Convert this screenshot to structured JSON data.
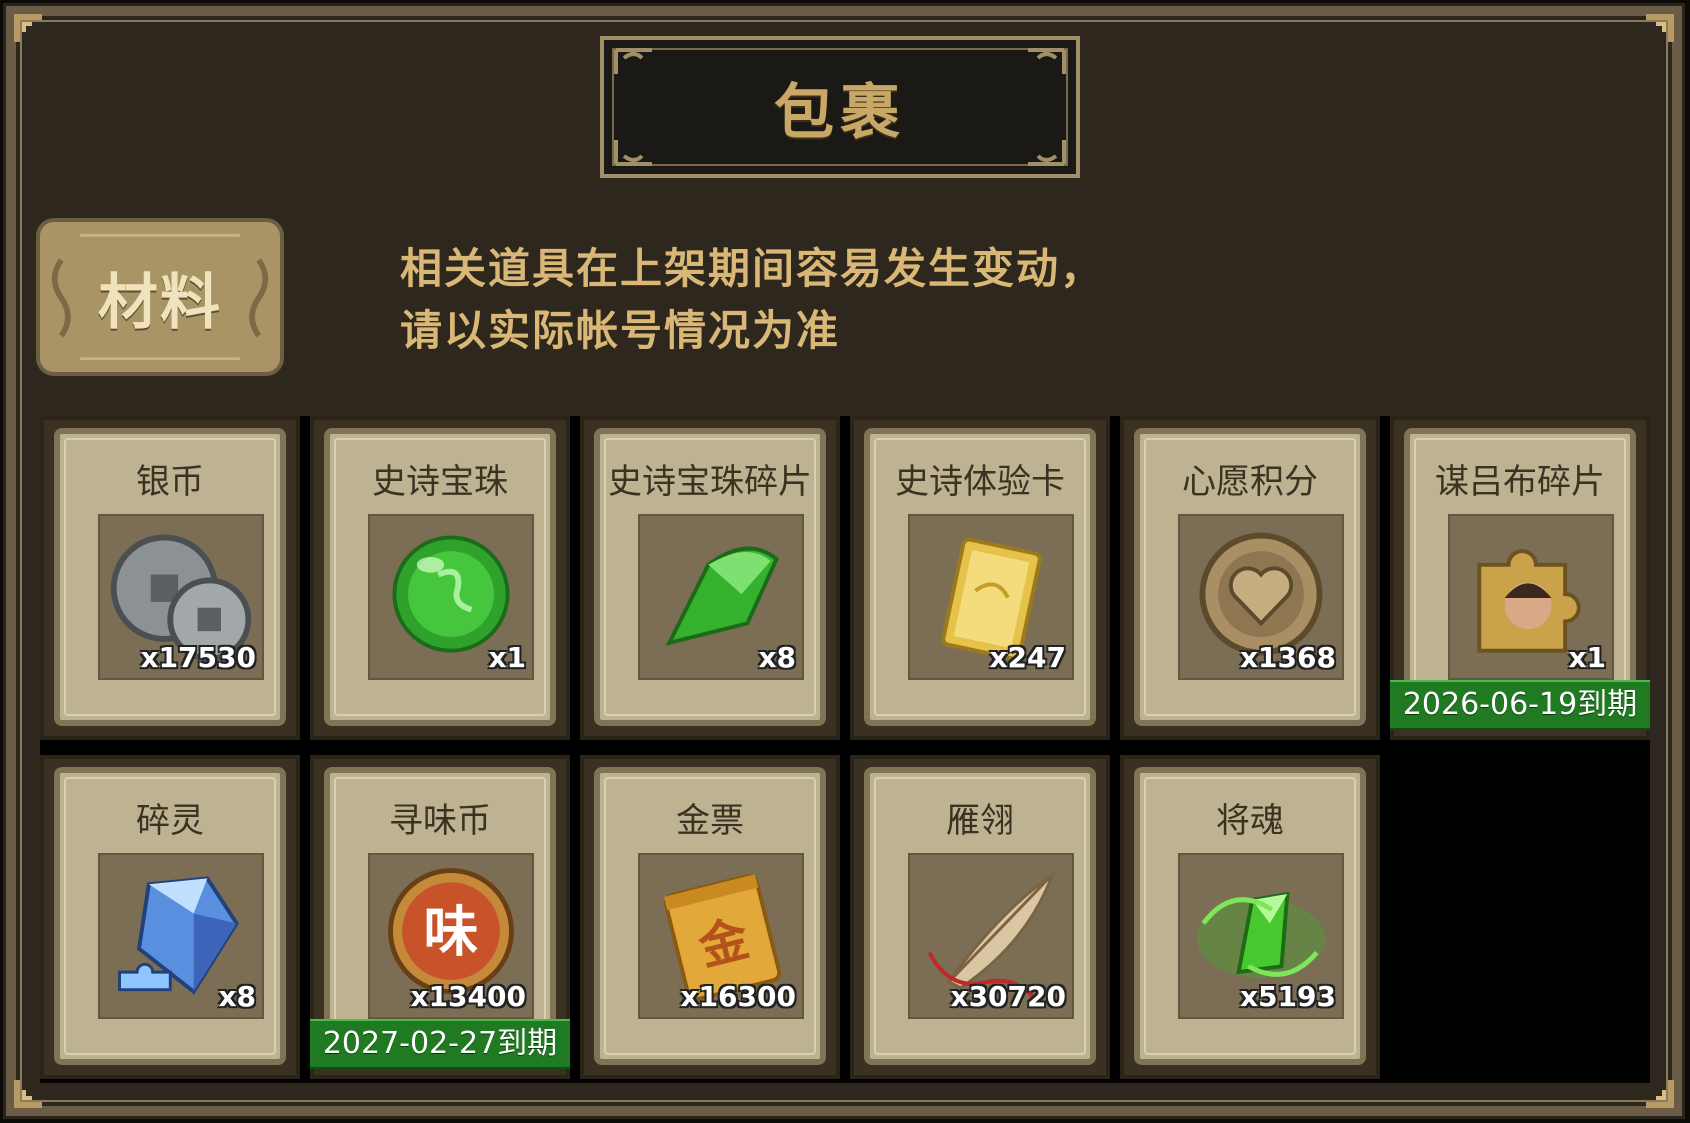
{
  "header": {
    "title": "包裹"
  },
  "category": {
    "label": "材料"
  },
  "notice": {
    "line1": "相关道具在上架期间容易发生变动，",
    "line2": "请以实际帐号情况为准"
  },
  "items_row1": [
    {
      "name": "银币",
      "qty": "x17530",
      "icon": "silver-coin-icon"
    },
    {
      "name": "史诗宝珠",
      "qty": "x1",
      "icon": "green-orb-icon"
    },
    {
      "name": "史诗宝珠碎片",
      "qty": "x8",
      "icon": "green-shard-icon"
    },
    {
      "name": "史诗体验卡",
      "qty": "x247",
      "icon": "gold-card-icon"
    },
    {
      "name": "心愿积分",
      "qty": "x1368",
      "icon": "heart-coin-icon"
    },
    {
      "name": "谋吕布碎片",
      "qty": "x1",
      "icon": "hero-puzzle-piece-icon",
      "expiry": "2026-06-19到期"
    }
  ],
  "items_row2": [
    {
      "name": "碎灵",
      "qty": "x8",
      "icon": "blue-crystal-icon"
    },
    {
      "name": "寻味币",
      "qty": "x13400",
      "icon": "taste-coin-icon",
      "coin_text": "味",
      "expiry": "2027-02-27到期"
    },
    {
      "name": "金票",
      "qty": "x16300",
      "icon": "gold-ticket-icon",
      "ticket_text": "金"
    },
    {
      "name": "雁翎",
      "qty": "x30720",
      "icon": "feather-icon"
    },
    {
      "name": "将魂",
      "qty": "x5193",
      "icon": "green-soul-crystal-icon"
    }
  ],
  "colors": {
    "frame": "#2e271d",
    "title_gold": "#c9a867",
    "card_parchment": "#bdb292",
    "expiry_green": "#1f7a22"
  }
}
